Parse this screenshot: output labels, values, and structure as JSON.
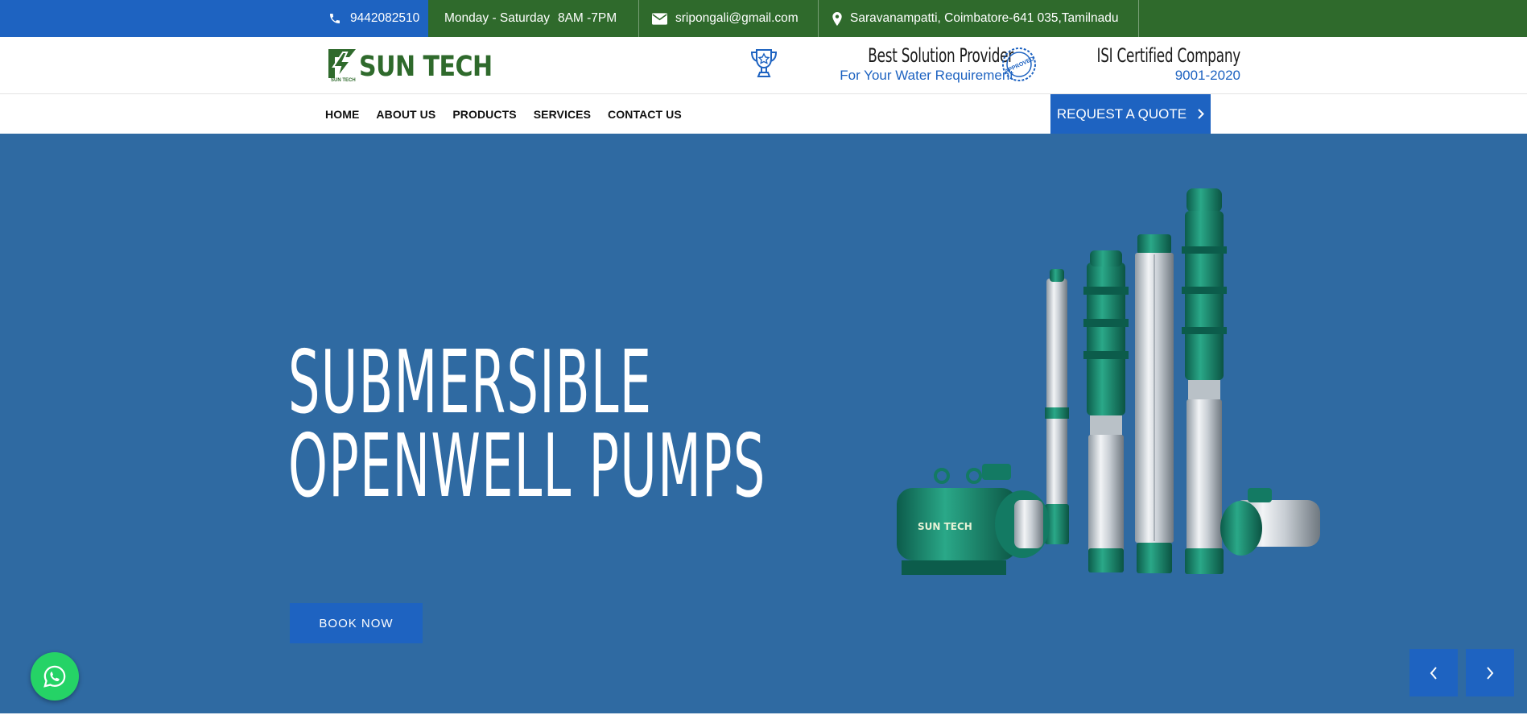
{
  "topbar": {
    "phone": "9442082510",
    "hours_days": "Monday - Saturday",
    "hours_time": "8AM -7PM",
    "email": "sripongali@gmail.com",
    "address": "Saravanampatti, Coimbatore-641 035,Tamilnadu"
  },
  "logo": {
    "name": "SUN TECH",
    "sub": "SUN TECH"
  },
  "header": {
    "block1_title": "Best Solution Provider",
    "block1_sub": "For Your Water Requirement",
    "block2_title": "ISI Certified Company",
    "block2_sub": "9001-2020",
    "seal_text": "APPROVED"
  },
  "nav": {
    "items": [
      "HOME",
      "ABOUT US",
      "PRODUCTS",
      "SERVICES",
      "CONTACT US"
    ],
    "quote_label": "REQUEST A QUOTE"
  },
  "hero": {
    "title_line1": "SUBMERSIBLE",
    "title_line2": "OPENWELL PUMPS",
    "button_label": "BOOK NOW",
    "pump_brand": "SUN TECH"
  },
  "colors": {
    "brand_blue": "#1e63c1",
    "brand_green": "#2f6a2c",
    "hero_bg": "#2f6aa2",
    "pump_green": "#16806a",
    "whatsapp": "#25d366"
  }
}
